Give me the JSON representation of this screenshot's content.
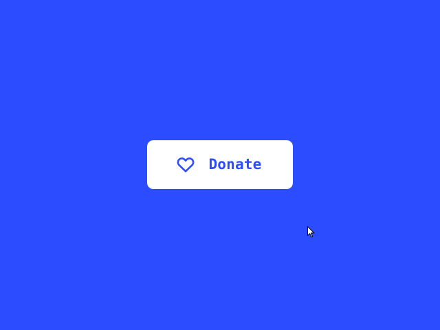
{
  "colors": {
    "background": "#2b4cff",
    "button_background": "#ffffff",
    "button_text": "#2b4cff",
    "cursor_fill": "#ffffff",
    "cursor_stroke": "#000000"
  },
  "donate_button": {
    "label": "Donate",
    "icon": "heart-outline-icon"
  },
  "cursor": {
    "icon": "mouse-pointer-arrow-icon"
  }
}
